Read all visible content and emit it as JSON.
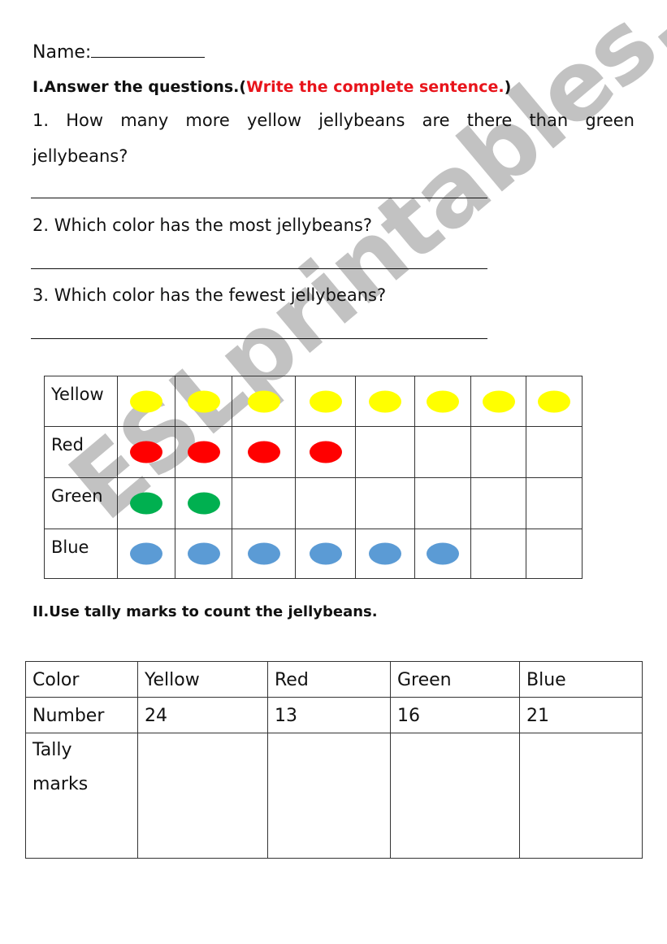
{
  "header": {
    "name_label": "Name:"
  },
  "section1": {
    "heading": "I.Answer the questions.",
    "open_paren": "(",
    "instruction": "Write the complete sentence.",
    "close_paren": ")",
    "questions": [
      {
        "text_line1": "1. How many more yellow jellybeans are there than green",
        "text_line2": "jellybeans?"
      },
      {
        "text_line1": "2. Which color has the most jellybeans?"
      },
      {
        "text_line1": "3. Which color has the fewest jellybeans?"
      }
    ]
  },
  "pictograph": {
    "rows": [
      {
        "label": "Yellow",
        "count": 8,
        "color": "#ffff00"
      },
      {
        "label": "Red",
        "count": 4,
        "color": "#ff0000"
      },
      {
        "label": "Green",
        "count": 2,
        "color": "#00b050"
      },
      {
        "label": "Blue",
        "count": 6,
        "color": "#5b9bd5"
      }
    ],
    "columns": 8
  },
  "section2": {
    "heading": "II.Use tally marks to count the jellybeans.",
    "table": {
      "row_headers": [
        "Color",
        "Number",
        "Tally marks"
      ],
      "colors": [
        "Yellow",
        "Red",
        "Green",
        "Blue"
      ],
      "numbers": [
        "24",
        "13",
        "16",
        "21"
      ]
    }
  },
  "watermark": "ESLprintables.com"
}
